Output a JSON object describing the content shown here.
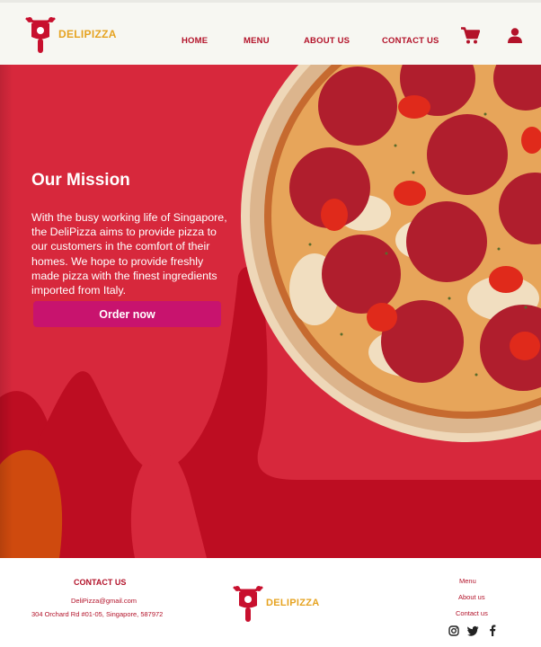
{
  "brand": {
    "name": "DELIPIZZA",
    "logo_icon": "scooter-icon"
  },
  "nav": {
    "items": [
      "HOME",
      "MENU",
      "ABOUT US",
      "CONTACT US"
    ],
    "cart_icon": "cart-icon",
    "account_icon": "user-icon"
  },
  "hero": {
    "title": "Our Mission",
    "text": "With the busy working life of Singapore, the DeliPizza aims to provide pizza to our customers in the comfort of their homes. We hope to provide freshly made pizza with the finest ingredients imported from Italy.",
    "cta_label": "Order now",
    "image": "pepperoni-pizza"
  },
  "footer": {
    "contact_title": "CONTACT US",
    "email": "DeliPizza@gmail.com",
    "address": "304 Orchard Rd #01-05, Singapore, 587972",
    "brand_name": "DELIPIZZA",
    "links": [
      "Menu",
      "About us",
      "Contact us"
    ],
    "social_icons": [
      "instagram-icon",
      "twitter-icon",
      "facebook-icon"
    ]
  },
  "colors": {
    "primary_red": "#b3132a",
    "hero_red": "#d7283c",
    "hero_dark_red": "#bd0d22",
    "accent_gold": "#e6a321",
    "button_magenta": "#c8136e",
    "header_bg": "#f7f7f2"
  }
}
